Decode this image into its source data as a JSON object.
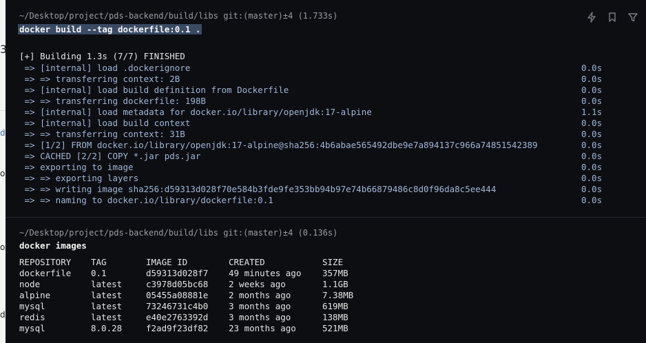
{
  "background_app": {
    "labels": [
      "3",
      "d",
      "ol",
      "ol",
      "d"
    ]
  },
  "terminal": {
    "toolbar": {
      "icons": [
        "lightning-icon",
        "bookmark-icon",
        "filter-icon"
      ]
    },
    "block1": {
      "prompt": "~/Desktop/project/pds-backend/build/libs git:(master)±4 (1.733s)",
      "command": "docker build --tag dockerfile:0.1 .",
      "header": "[+] Building 1.3s (7/7) FINISHED",
      "steps": [
        {
          "text": " => [internal] load .dockerignore",
          "time": "0.0s"
        },
        {
          "text": " => => transferring context: 2B",
          "time": "0.0s"
        },
        {
          "text": " => [internal] load build definition from Dockerfile",
          "time": "0.0s"
        },
        {
          "text": " => => transferring dockerfile: 198B",
          "time": "0.0s"
        },
        {
          "text": " => [internal] load metadata for docker.io/library/openjdk:17-alpine",
          "time": "1.1s"
        },
        {
          "text": " => [internal] load build context",
          "time": "0.0s"
        },
        {
          "text": " => => transferring context: 31B",
          "time": "0.0s"
        },
        {
          "text": " => [1/2] FROM docker.io/library/openjdk:17-alpine@sha256:4b6abae565492dbe9e7a894137c966a74851542389",
          "time": "0.0s"
        },
        {
          "text": " => CACHED [2/2] COPY *.jar pds.jar",
          "time": "0.0s"
        },
        {
          "text": " => exporting to image",
          "time": "0.0s"
        },
        {
          "text": " => => exporting layers",
          "time": "0.0s"
        },
        {
          "text": " => => writing image sha256:d59313d028f70e584b3fde9fe353bb94b97e74b66879486c8d0f96da8c5ee444",
          "time": "0.0s"
        },
        {
          "text": " => => naming to docker.io/library/dockerfile:0.1",
          "time": "0.0s"
        }
      ]
    },
    "block2": {
      "prompt": "~/Desktop/project/pds-backend/build/libs git:(master)±4 (0.136s)",
      "command": "docker images",
      "columns": [
        "REPOSITORY",
        "TAG",
        "IMAGE ID",
        "CREATED",
        "SIZE"
      ],
      "rows": [
        [
          "dockerfile",
          "0.1",
          "d59313d028f7",
          "49 minutes ago",
          "357MB"
        ],
        [
          "node",
          "latest",
          "c3978d05bc68",
          "2 weeks ago",
          "1.1GB"
        ],
        [
          "alpine",
          "latest",
          "05455a08881e",
          "2 months ago",
          "7.38MB"
        ],
        [
          "mysql",
          "latest",
          "73246731c4b0",
          "3 months ago",
          "619MB"
        ],
        [
          "redis",
          "latest",
          "e40e2763392d",
          "3 months ago",
          "138MB"
        ],
        [
          "mysql",
          "8.0.28",
          "f2ad9f23df82",
          "23 months ago",
          "521MB"
        ]
      ]
    }
  }
}
